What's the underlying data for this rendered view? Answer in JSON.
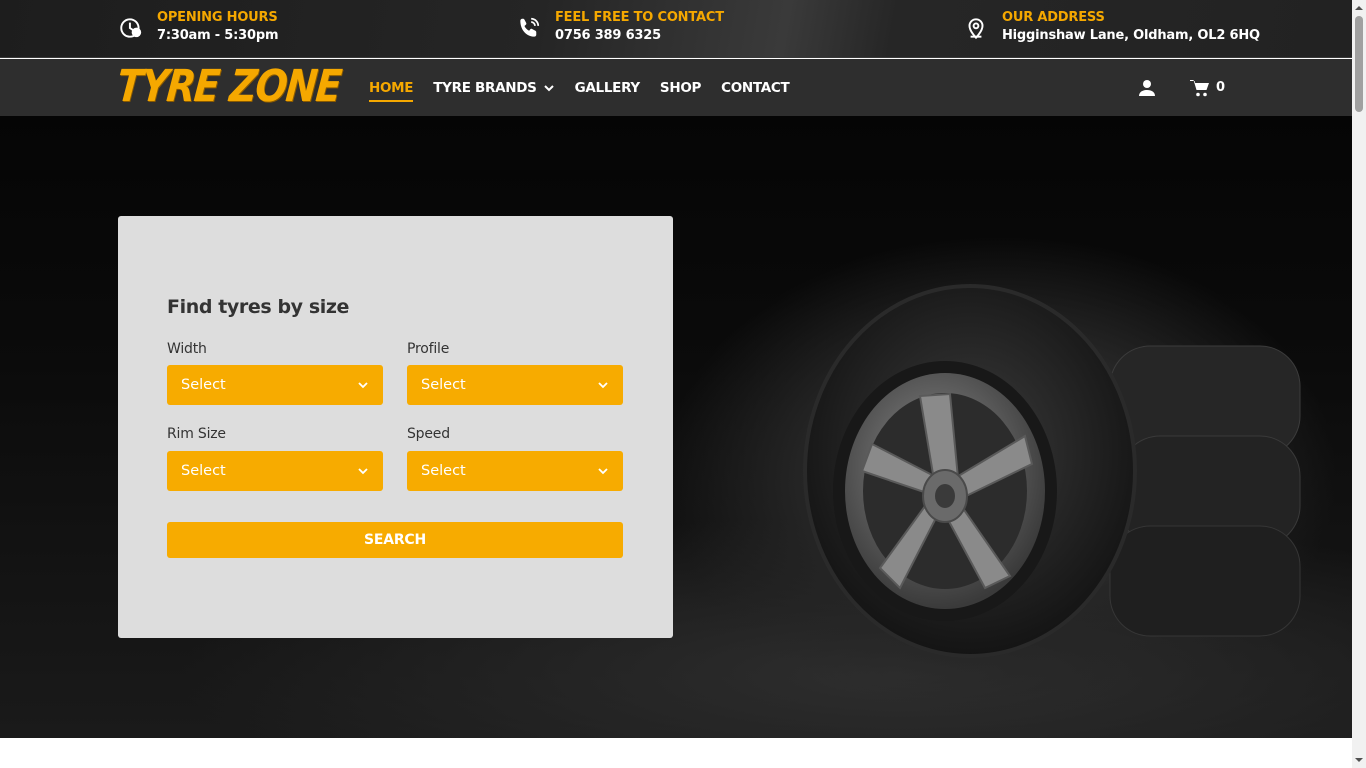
{
  "topbar": {
    "hours": {
      "title": "OPENING HOURS",
      "value": "7:30am - 5:30pm",
      "icon": "clock-icon"
    },
    "contact": {
      "title": "FEEL FREE TO CONTACT",
      "value": "0756 389 6325",
      "icon": "phone-icon"
    },
    "address": {
      "title": "OUR ADDRESS",
      "value": "Higginshaw Lane, Oldham, OL2 6HQ",
      "icon": "map-pin-icon"
    }
  },
  "nav": {
    "logo": "TYRE ZONE",
    "items": [
      {
        "label": "HOME",
        "active": true
      },
      {
        "label": "TYRE BRANDS",
        "has_dropdown": true
      },
      {
        "label": "GALLERY"
      },
      {
        "label": "SHOP"
      },
      {
        "label": "CONTACT"
      }
    ],
    "cart_count": "0"
  },
  "search": {
    "title": "Find tyres by size",
    "fields": [
      {
        "label": "Width",
        "value": "Select"
      },
      {
        "label": "Profile",
        "value": "Select"
      },
      {
        "label": "Rim Size",
        "value": "Select"
      },
      {
        "label": "Speed",
        "value": "Select"
      }
    ],
    "button": "SEARCH"
  },
  "colors": {
    "accent": "#f7ab00",
    "bar_dark": "#2e2e2e",
    "card_bg": "#dddddd"
  }
}
